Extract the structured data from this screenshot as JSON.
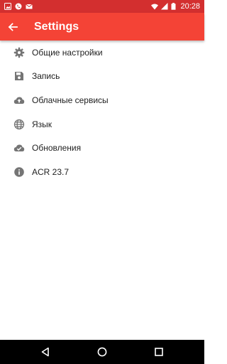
{
  "status_bar": {
    "time": "20:28",
    "icons": [
      "image-icon",
      "phone-icon",
      "mail-icon",
      "wifi-icon",
      "signal-icon",
      "battery-icon"
    ]
  },
  "app_bar": {
    "title": "Settings",
    "back_icon": "arrow-left-icon"
  },
  "settings": {
    "items": [
      {
        "label": "Общие настройки",
        "icon": "gear-icon"
      },
      {
        "label": "Запись",
        "icon": "floppy-icon"
      },
      {
        "label": "Облачные сервисы",
        "icon": "cloud-upload-icon"
      },
      {
        "label": "Язык",
        "icon": "globe-icon"
      },
      {
        "label": "Обновления",
        "icon": "cloud-done-icon"
      },
      {
        "label": "ACR 23.7",
        "icon": "info-icon"
      }
    ]
  },
  "navigation": {
    "buttons": [
      "back-triangle-icon",
      "home-circle-icon",
      "recents-square-icon"
    ]
  },
  "colors": {
    "status_bar": "#d32f2f",
    "app_bar": "#f44336",
    "icon": "#757575",
    "text": "#212121",
    "nav_bar": "#000000"
  }
}
